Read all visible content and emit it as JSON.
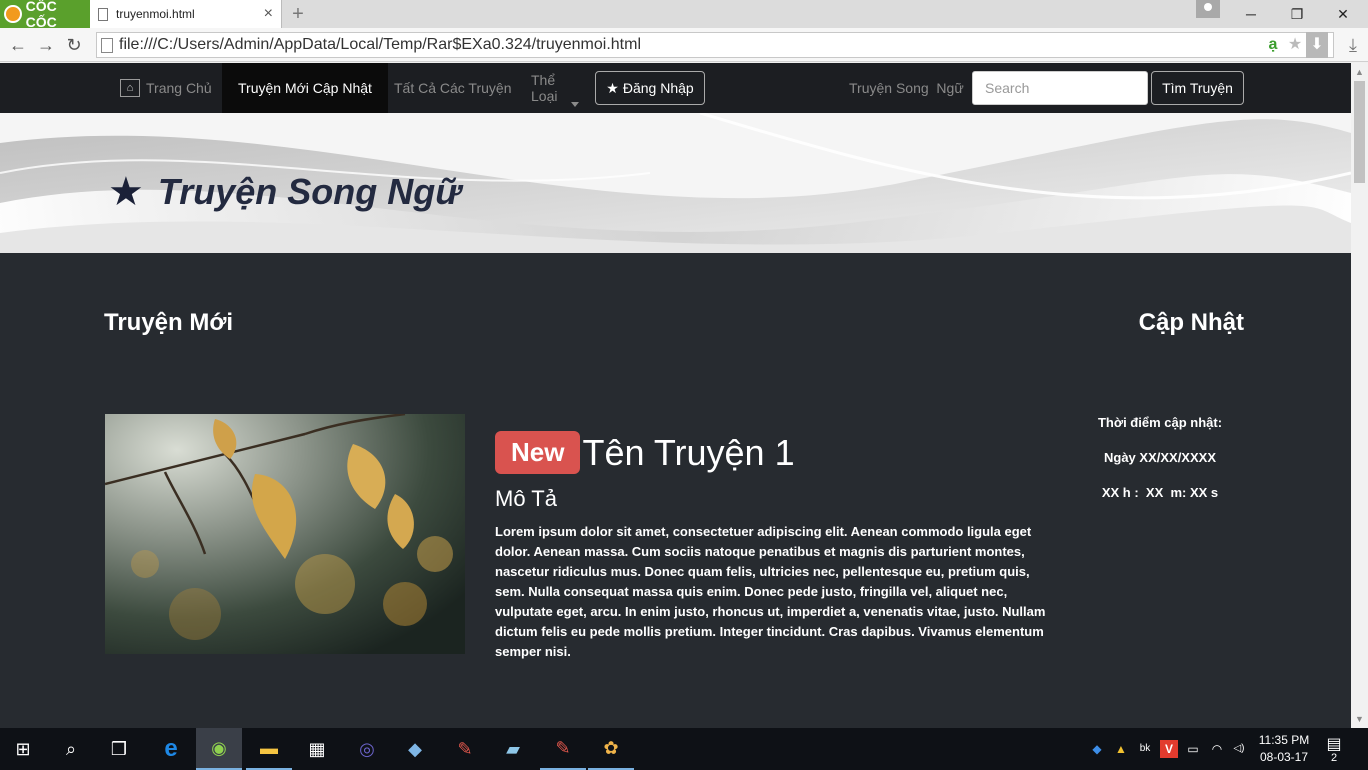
{
  "browser": {
    "brand": "CỐC CỐC",
    "tab_title": "truyenmoi.html",
    "tab_close": "×",
    "new_tab": "+",
    "minimize": "─",
    "restore": "❐",
    "close": "✕",
    "back": "←",
    "forward": "→",
    "reload": "↻",
    "url": "file:///C:/Users/Admin/AppData/Local/Temp/Rar$EXa0.324/truyenmoi.html",
    "addon_a": "ạ",
    "bookmark_star": "★",
    "addon_dl": "⬇",
    "download": "⤓"
  },
  "nav": {
    "home": "Trang Chủ",
    "home_icon": "⌂",
    "recent": "Truyện Mới Cập Nhật",
    "all": "Tất Cả Các Truyện",
    "genres": "Thể Loại",
    "login": "Đăng Nhập",
    "login_icon": "★",
    "bilingual": "Truyện Song  Ngữ",
    "search_placeholder": "Search",
    "search_button": "Tìm Truyện"
  },
  "banner": {
    "title": "Truyện Song Ngữ",
    "star": "★"
  },
  "main": {
    "section_left": "Truyện Mới",
    "section_right": "Cập Nhật",
    "story": {
      "badge": "New",
      "title": "Tên Truyện 1",
      "desc_title": "Mô Tả",
      "body": "Lorem ipsum dolor sit amet, consectetuer adipiscing elit. Aenean commodo ligula eget dolor. Aenean massa. Cum sociis natoque penatibus et magnis dis parturient montes, nascetur ridiculus mus. Donec quam felis, ultricies nec, pellentesque eu, pretium quis, sem. Nulla consequat massa quis enim. Donec pede justo, fringilla vel, aliquet nec, vulputate eget, arcu. In enim justo, rhoncus ut, imperdiet a, venenatis vitae, justo. Nullam dictum felis eu pede mollis pretium. Integer tincidunt. Cras dapibus. Vivamus elementum semper nisi."
    },
    "update": {
      "label": "Thời điểm cập nhật:",
      "date": "Ngày XX/XX/XXXX",
      "time": "XX h :  XX  m: XX s"
    }
  },
  "taskbar": {
    "start": "⊞",
    "search": "⌕",
    "taskview": "❒",
    "edge": "e",
    "coccoc": "◉",
    "explorer": "▬",
    "store": "▦",
    "eclipse": "◎",
    "app_cube": "◆",
    "app_pen": "✎",
    "app_book": "▰",
    "app_pen2": "✎",
    "app_paint": "✿",
    "tray_dropbox": "◆",
    "tray_drive": "▲",
    "tray_bk": "bk",
    "tray_v": "V",
    "tray_battery": "▭",
    "tray_wifi": "◠",
    "tray_volume": "◁)",
    "time": "11:35 PM",
    "date": "08-03-17",
    "notifications": "2"
  },
  "colors": {
    "page_bg": "#272b30",
    "navbar_bg": "#1c1e22",
    "badge_new": "#d9534f",
    "banner_title": "#232a40"
  }
}
